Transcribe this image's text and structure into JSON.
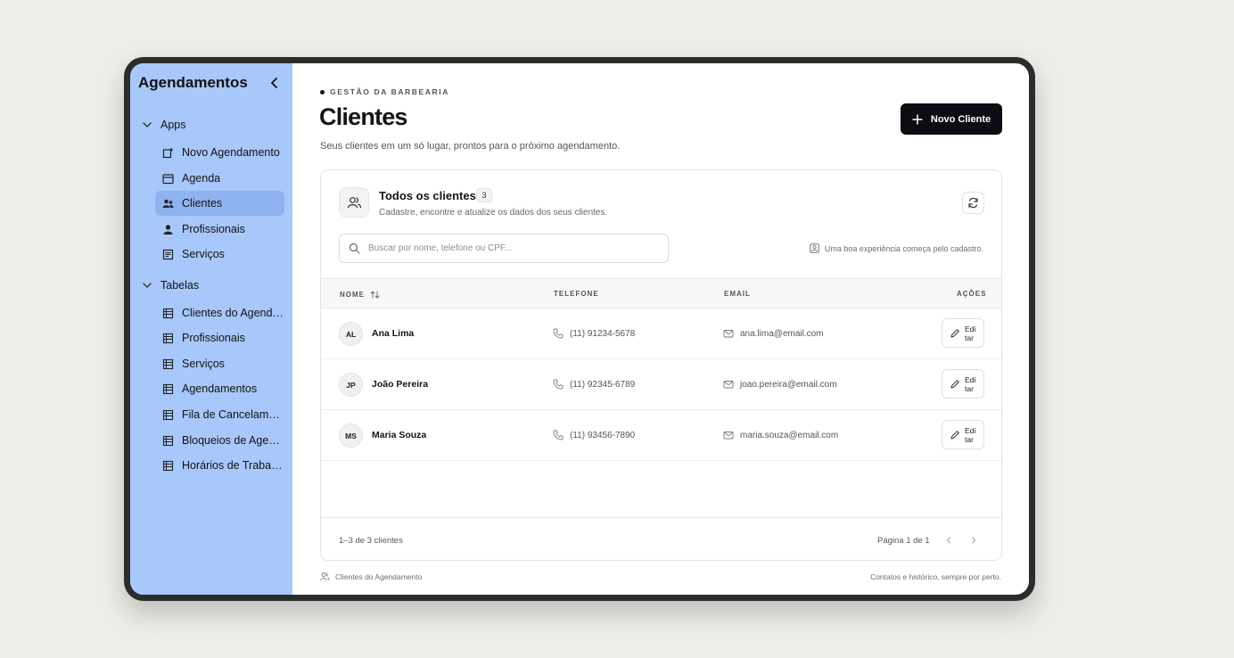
{
  "sidebar": {
    "title": "Agendamentos",
    "groups": [
      {
        "label": "Apps",
        "items": [
          {
            "label": "Novo Agendamento",
            "icon": "new-appointment-icon"
          },
          {
            "label": "Agenda",
            "icon": "calendar-icon"
          },
          {
            "label": "Clientes",
            "icon": "users-icon",
            "active": true
          },
          {
            "label": "Profissionais",
            "icon": "user-icon"
          },
          {
            "label": "Serviços",
            "icon": "list-icon"
          }
        ]
      },
      {
        "label": "Tabelas",
        "items": [
          {
            "label": "Clientes do Agendamento",
            "icon": "table-icon"
          },
          {
            "label": "Profissionais",
            "icon": "table-icon"
          },
          {
            "label": "Serviços",
            "icon": "table-icon"
          },
          {
            "label": "Agendamentos",
            "icon": "table-icon"
          },
          {
            "label": "Fila de Cancelamentos",
            "icon": "table-icon"
          },
          {
            "label": "Bloqueios de Agenda",
            "icon": "table-icon"
          },
          {
            "label": "Horários de Trabalho",
            "icon": "table-icon"
          }
        ]
      }
    ]
  },
  "header": {
    "eyebrow": "GESTÃO DA BARBEARIA",
    "title": "Clientes",
    "subtitle": "Seus clientes em um só lugar, prontos para o próximo agendamento.",
    "new_button": "Novo Cliente"
  },
  "card": {
    "title": "Todos os clientes",
    "count": "3",
    "subtitle": "Cadastre, encontre e atualize os dados dos seus clientes.",
    "search_placeholder": "Buscar por nome, telefone ou CPF...",
    "hint": "Uma boa experiência começa pelo cadastro.",
    "columns": {
      "name": "NOME",
      "phone": "TELEFONE",
      "email": "EMAIL",
      "actions": "AÇÕES"
    },
    "rows": [
      {
        "initials": "AL",
        "name": "Ana Lima",
        "phone": "(11) 91234-5678",
        "email": "ana.lima@email.com",
        "action": "Editar"
      },
      {
        "initials": "JP",
        "name": "João Pereira",
        "phone": "(11) 92345-6789",
        "email": "joao.pereira@email.com",
        "action": "Editar"
      },
      {
        "initials": "MS",
        "name": "Maria Souza",
        "phone": "(11) 93456-7890",
        "email": "maria.souza@email.com",
        "action": "Editar"
      }
    ],
    "range": "1–3 de 3 clientes",
    "page_info": "Página 1 de 1"
  },
  "footer": {
    "left": "Clientes do Agendamento",
    "right": "Contatos e histórico, sempre por perto."
  },
  "colors": {
    "sidebar_bg": "#a8c8fc",
    "sidebar_active": "#8fb3f0",
    "primary": "#0c0c12"
  }
}
